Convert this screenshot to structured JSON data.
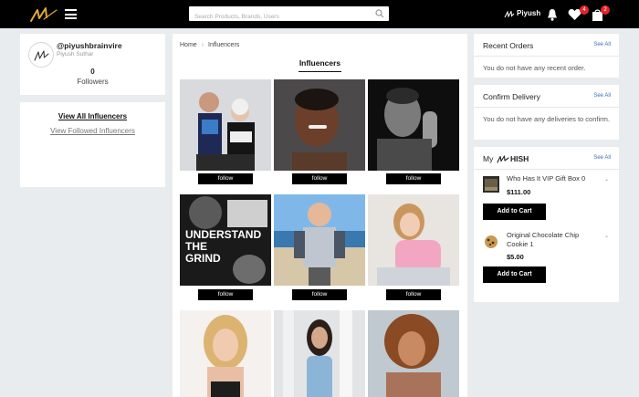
{
  "header": {
    "search_placeholder": "Search Products, Brands, Users",
    "username": "Piyush",
    "wishlist_count": "4",
    "cart_count": "2"
  },
  "profile": {
    "handle": "@piyushbrainvire",
    "full_name": "Piyush Suthar",
    "followers_count": "0",
    "followers_label": "Followers"
  },
  "links": {
    "view_all": "View All Influencers",
    "view_followed": "View Followed Influencers"
  },
  "breadcrumb": {
    "home": "Home",
    "current": "Influencers"
  },
  "center": {
    "title": "Influencers",
    "follow_label": "follow",
    "influencer_photos": [
      "protest-shirt-photo",
      "smiling-man-photo",
      "praying-man-photo",
      "understand-the-grind-poster-photo",
      "boy-change-the-world-photo",
      "pink-sweater-woman-photo",
      "blonde-woman-photo",
      "woman-blue-dress-photo",
      "curly-hair-woman-photo"
    ]
  },
  "recent_orders": {
    "title": "Recent Orders",
    "see_all": "See All",
    "empty_text": "You do not have any recent order."
  },
  "confirm_delivery": {
    "title": "Confirm Delivery",
    "see_all": "See All",
    "empty_text": "You do not have any deliveries to confirm."
  },
  "wishlist": {
    "prefix": "My",
    "brand": "HISH",
    "see_all": "See All",
    "items": [
      {
        "name": "Who Has It VIP Gift Box 0",
        "price": "$111.00",
        "button": "Add to Cart"
      },
      {
        "name": "Original Chocolate Chip Cookie 1",
        "price": "$5.00",
        "button": "Add to Cart"
      }
    ]
  },
  "colors": {
    "accent_gold": "#e0a93a",
    "badge_red": "#e5252b",
    "link_blue": "#3b6fb6"
  }
}
